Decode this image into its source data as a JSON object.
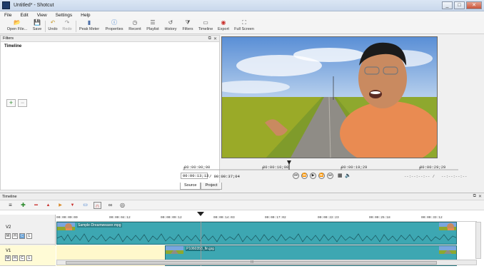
{
  "window": {
    "title": "Untitled* - Shotcut",
    "controls": [
      "_",
      "□",
      "✕"
    ]
  },
  "menu": [
    "File",
    "Edit",
    "View",
    "Settings",
    "Help"
  ],
  "toolbar": [
    {
      "label": "Open File...",
      "icon": "folder-open-icon",
      "glyph": "📂",
      "disabled": false
    },
    {
      "label": "Save",
      "icon": "save-icon",
      "glyph": "💾",
      "disabled": false
    },
    {
      "label": "Undo",
      "icon": "undo-icon",
      "glyph": "↶",
      "disabled": false
    },
    {
      "label": "Redo",
      "icon": "redo-icon",
      "glyph": "↷",
      "disabled": true
    },
    {
      "label": "Peak Meter",
      "icon": "peak-meter-icon",
      "glyph": "▮",
      "disabled": false
    },
    {
      "label": "Properties",
      "icon": "properties-icon",
      "glyph": "ⓘ",
      "disabled": false
    },
    {
      "label": "Recent",
      "icon": "recent-icon",
      "glyph": "◷",
      "disabled": false
    },
    {
      "label": "Playlist",
      "icon": "playlist-icon",
      "glyph": "☰",
      "disabled": false
    },
    {
      "label": "History",
      "icon": "history-icon",
      "glyph": "↺",
      "disabled": false
    },
    {
      "label": "Filters",
      "icon": "filters-icon",
      "glyph": "⧩",
      "disabled": false
    },
    {
      "label": "Timeline",
      "icon": "timeline-icon",
      "glyph": "▭",
      "disabled": false
    },
    {
      "label": "Export",
      "icon": "export-icon",
      "glyph": "◉",
      "disabled": false
    },
    {
      "label": "Full Screen",
      "icon": "fullscreen-icon",
      "glyph": "⛶",
      "disabled": false
    }
  ],
  "filters_panel": {
    "header": "Filters",
    "subtitle": "Timeline",
    "add_glyph": "+",
    "remove_glyph": "−"
  },
  "player": {
    "ruler_times": [
      "00:00:00;00",
      "00:00:10;00",
      "00:00:19;29",
      "00:00:29;29"
    ],
    "current_time": "00:00:13;13",
    "duration": "/ 00:00:37;04",
    "in_point": "--:--:--:-- /",
    "out_point": "--:--:--:--",
    "transport": [
      "⏮",
      "⏪",
      "▶",
      "⏩",
      "⏭"
    ],
    "tabs": [
      "Source",
      "Project"
    ]
  },
  "timeline": {
    "header": "Timeline",
    "ruler": [
      "00:00:00:00",
      "00:00:04:12",
      "00:00:09:12",
      "00:00:14:03",
      "00:00:17:02",
      "00:00:22:23",
      "00:00:25:18",
      "00:00:33:12"
    ],
    "tracks": [
      {
        "name": "V2",
        "buttons": [
          "M",
          "H",
          "C",
          "L"
        ],
        "clip": "Sample-Dreamweaver.mpg"
      },
      {
        "name": "V1",
        "buttons": [
          "M",
          "H",
          "C",
          "L"
        ],
        "clip": "P1060358_fin.jpg"
      }
    ],
    "scroll_label": "III"
  },
  "colors": {
    "clip": "#3da7b2",
    "selected_track": "#fffbd6",
    "accent": "#6ba4d8"
  }
}
